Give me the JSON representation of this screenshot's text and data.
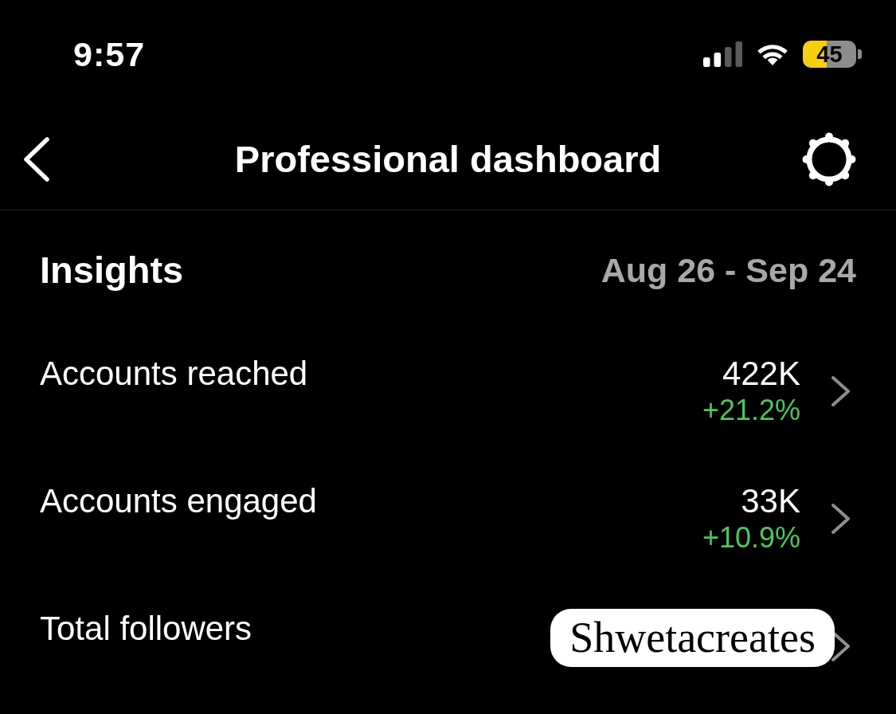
{
  "status_bar": {
    "time": "9:57",
    "battery": {
      "percent": "45",
      "low_power": true
    }
  },
  "header": {
    "title": "Professional dashboard"
  },
  "insights": {
    "title": "Insights",
    "date_range": "Aug 26 - Sep 24",
    "rows": [
      {
        "label": "Accounts reached",
        "value": "422K",
        "change": "+21.2%",
        "color": "#4cc75a"
      },
      {
        "label": "Accounts engaged",
        "value": "33K",
        "change": "+10.9%",
        "color": "#4cc75a"
      },
      {
        "label": "Total followers"
      }
    ]
  },
  "sticker": {
    "text": "Shwetacreates"
  }
}
